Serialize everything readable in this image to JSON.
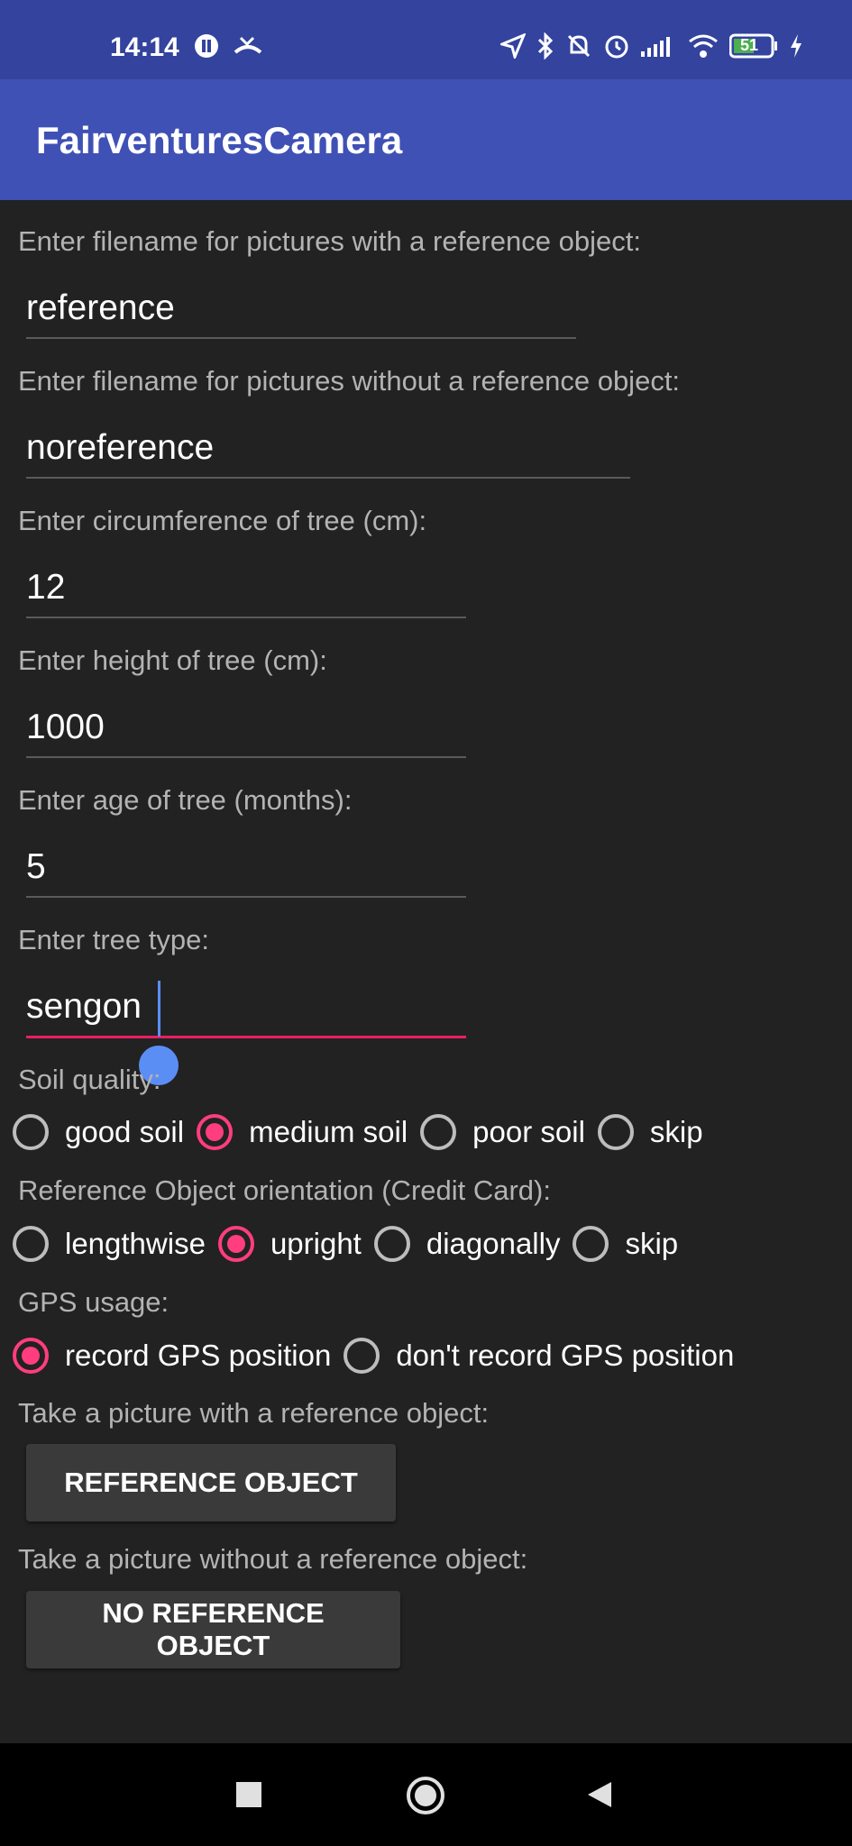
{
  "status": {
    "time": "14:14",
    "battery": "51",
    "icons": [
      "notification-icon",
      "missed-call-icon",
      "location-icon",
      "bluetooth-icon",
      "mute-icon",
      "alarm-icon",
      "signal-icon",
      "wifi-icon",
      "battery-icon",
      "charging-icon"
    ]
  },
  "app": {
    "title": "FairventuresCamera"
  },
  "form": {
    "ref_filename_label": "Enter filename for pictures with a reference object:",
    "ref_filename_value": "reference",
    "noref_filename_label": "Enter filename for pictures without a reference object:",
    "noref_filename_value": "noreference",
    "circumference_label": "Enter circumference of tree (cm):",
    "circumference_value": "12",
    "height_label": "Enter height of tree (cm):",
    "height_value": "1000",
    "age_label": "Enter age of tree (months):",
    "age_value": "5",
    "type_label": "Enter tree type:",
    "type_value": "sengon",
    "soil_label": "Soil quality:",
    "soil_options": [
      "good soil",
      "medium soil",
      "poor soil",
      "skip"
    ],
    "soil_selected": "medium soil",
    "orientation_label": "Reference Object orientation (Credit Card):",
    "orientation_options": [
      "lengthwise",
      "upright",
      "diagonally",
      "skip"
    ],
    "orientation_selected": "upright",
    "gps_label": "GPS usage:",
    "gps_options": [
      "record GPS position",
      "don't record GPS position"
    ],
    "gps_selected": "record GPS position",
    "take_ref_label": "Take a picture with a reference object:",
    "ref_button": "REFERENCE OBJECT",
    "take_noref_label": "Take a picture without a reference object:",
    "noref_button": "NO REFERENCE OBJECT"
  },
  "colors": {
    "status_bar": "#33439e",
    "app_bar": "#3f51b5",
    "background": "#222222",
    "accent": "#ff3d7f",
    "cursor": "#5b8ef5"
  }
}
